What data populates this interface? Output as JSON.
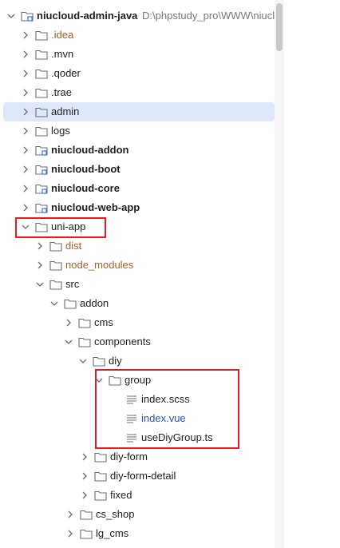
{
  "project": {
    "name": "niucloud-admin-java",
    "path": "D:\\phpstudy_pro\\WWW\\niuclo"
  },
  "tree": [
    {
      "label": ".idea",
      "kind": "folder",
      "style": "brown"
    },
    {
      "label": ".mvn",
      "kind": "folder",
      "style": "normal"
    },
    {
      "label": ".qoder",
      "kind": "folder",
      "style": "normal"
    },
    {
      "label": ".trae",
      "kind": "folder",
      "style": "normal"
    },
    {
      "label": "admin",
      "kind": "folder",
      "style": "normal",
      "selected": true
    },
    {
      "label": "logs",
      "kind": "folder",
      "style": "normal"
    },
    {
      "label": "niucloud-addon",
      "kind": "module",
      "style": "bold"
    },
    {
      "label": "niucloud-boot",
      "kind": "module",
      "style": "bold"
    },
    {
      "label": "niucloud-core",
      "kind": "module",
      "style": "bold"
    },
    {
      "label": "niucloud-web-app",
      "kind": "module",
      "style": "bold"
    },
    {
      "label": "uni-app",
      "kind": "folder",
      "style": "normal",
      "expanded": true
    },
    {
      "label": "dist",
      "kind": "folder",
      "style": "brown"
    },
    {
      "label": "node_modules",
      "kind": "folder",
      "style": "brown"
    },
    {
      "label": "src",
      "kind": "folder",
      "style": "normal",
      "expanded": true
    },
    {
      "label": "addon",
      "kind": "folder",
      "style": "normal",
      "expanded": true
    },
    {
      "label": "cms",
      "kind": "folder",
      "style": "normal"
    },
    {
      "label": "components",
      "kind": "folder",
      "style": "normal",
      "expanded": true
    },
    {
      "label": "diy",
      "kind": "folder",
      "style": "normal",
      "expanded": true
    },
    {
      "label": "group",
      "kind": "folder",
      "style": "normal",
      "expanded": true
    },
    {
      "label": "index.scss",
      "kind": "file",
      "style": "normal"
    },
    {
      "label": "index.vue",
      "kind": "file",
      "style": "blue"
    },
    {
      "label": "useDiyGroup.ts",
      "kind": "file",
      "style": "normal"
    },
    {
      "label": "diy-form",
      "kind": "folder",
      "style": "normal"
    },
    {
      "label": "diy-form-detail",
      "kind": "folder",
      "style": "normal"
    },
    {
      "label": "fixed",
      "kind": "folder",
      "style": "normal"
    },
    {
      "label": "cs_shop",
      "kind": "folder",
      "style": "normal"
    },
    {
      "label": "lg_cms",
      "kind": "folder",
      "style": "normal"
    }
  ]
}
